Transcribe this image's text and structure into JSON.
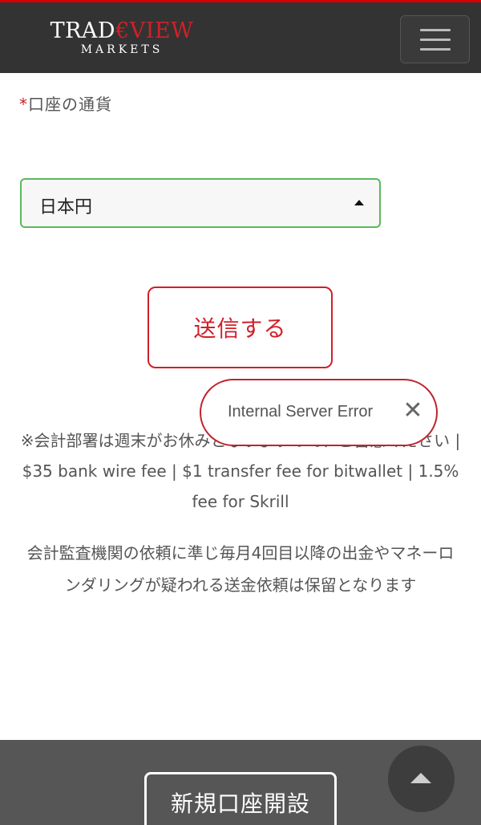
{
  "header": {
    "logo_part1": "TRAD",
    "logo_accent": "€VIEW",
    "logo_sub": "MARKETS",
    "menu_icon": "hamburger-menu-icon",
    "colors": {
      "bar": "#333333",
      "accent": "#d0202a"
    }
  },
  "form": {
    "required_mark": "*",
    "currency_label": "口座の通貨",
    "currency_selected": "日本円",
    "submit_label": "送信する"
  },
  "notes": {
    "accounting_note": "※会計部署は週末がお休みとなりますので、ご留意ください | $35 bank wire fee | $1 transfer fee for bitwallet | 1.5% fee for Skrill",
    "audit_note": "会計監査機関の依頼に準じ毎月4回目以降の出金やマネーロンダリングが疑われる送金依頼は保留となります"
  },
  "toast": {
    "message": "Internal Server Error",
    "close_symbol": "✕"
  },
  "footer": {
    "new_account_label": "新規口座開設",
    "to_top_icon": "arrow-up-icon"
  }
}
